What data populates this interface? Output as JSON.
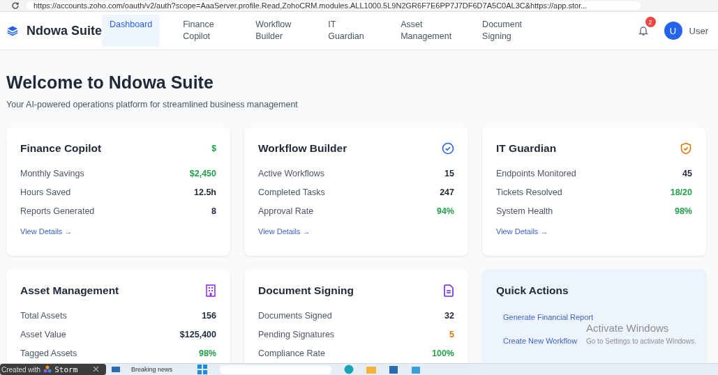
{
  "browser": {
    "url": "https://accounts.zoho.com/oauth/v2/auth?scope=AaaServer.profile.Read,ZohoCRM.modules.ALL1000.5L9N2GR6F7E6PP7J7DF6D7A5C0AL3C&https://app.stor..."
  },
  "header": {
    "brand": "Ndowa Suite",
    "nav": [
      {
        "label": "Dashboard",
        "selected": true
      },
      {
        "label": "Finance Copilot",
        "selected": false
      },
      {
        "label": "Workflow Builder",
        "selected": false
      },
      {
        "label": "IT Guardian",
        "selected": false
      },
      {
        "label": "Asset Management",
        "selected": false
      },
      {
        "label": "Document Signing",
        "selected": false
      }
    ],
    "notifications": "2",
    "user": {
      "initial": "U",
      "name": "User"
    }
  },
  "page": {
    "title": "Welcome to Ndowa Suite",
    "subtitle": "Your AI-powered operations platform for streamlined business management"
  },
  "cards": [
    {
      "title": "Finance Copilot",
      "kind": "symbol",
      "symbol": "$",
      "rows": [
        {
          "label": "Monthly Savings",
          "value": "$2,450",
          "color": "#22a04b"
        },
        {
          "label": "Hours Saved",
          "value": "12.5h",
          "color": "#1f2937"
        },
        {
          "label": "Reports Generated",
          "value": "8",
          "color": "#1f2937"
        }
      ],
      "link": "View Details →"
    },
    {
      "title": "Workflow Builder",
      "kind": "check",
      "rows": [
        {
          "label": "Active Workflows",
          "value": "15",
          "color": "#1f2937"
        },
        {
          "label": "Completed Tasks",
          "value": "247",
          "color": "#1f2937"
        },
        {
          "label": "Approval Rate",
          "value": "94%",
          "color": "#22a04b"
        }
      ],
      "link": "View Details →"
    },
    {
      "title": "IT Guardian",
      "kind": "shield",
      "rows": [
        {
          "label": "Endpoints Monitored",
          "value": "45",
          "color": "#1f2937"
        },
        {
          "label": "Tickets Resolved",
          "value": "18/20",
          "color": "#22a04b"
        },
        {
          "label": "System Health",
          "value": "98%",
          "color": "#22a04b"
        }
      ],
      "link": "View Details →"
    },
    {
      "title": "Asset Management",
      "kind": "building",
      "rows": [
        {
          "label": "Total Assets",
          "value": "156",
          "color": "#1f2937"
        },
        {
          "label": "Asset Value",
          "value": "$125,400",
          "color": "#1f2937"
        },
        {
          "label": "Tagged Assets",
          "value": "98%",
          "color": "#22a04b"
        }
      ]
    },
    {
      "title": "Document Signing",
      "kind": "document",
      "rows": [
        {
          "label": "Documents Signed",
          "value": "32",
          "color": "#1f2937"
        },
        {
          "label": "Pending Signatures",
          "value": "5",
          "color": "#d97706"
        },
        {
          "label": "Compliance Rate",
          "value": "100%",
          "color": "#22a04b"
        }
      ]
    }
  ],
  "quick_actions": {
    "title": "Quick Actions",
    "actions": [
      "Generate Financial Report",
      "Create New Workflow"
    ]
  },
  "toast": {
    "prefix": "Created with",
    "brand": "Storm"
  },
  "os_notice": {
    "title": "Activate Windows",
    "subtitle": "Go to Settings to activate Windows."
  },
  "taskbar": {
    "news": "Breaking news"
  }
}
